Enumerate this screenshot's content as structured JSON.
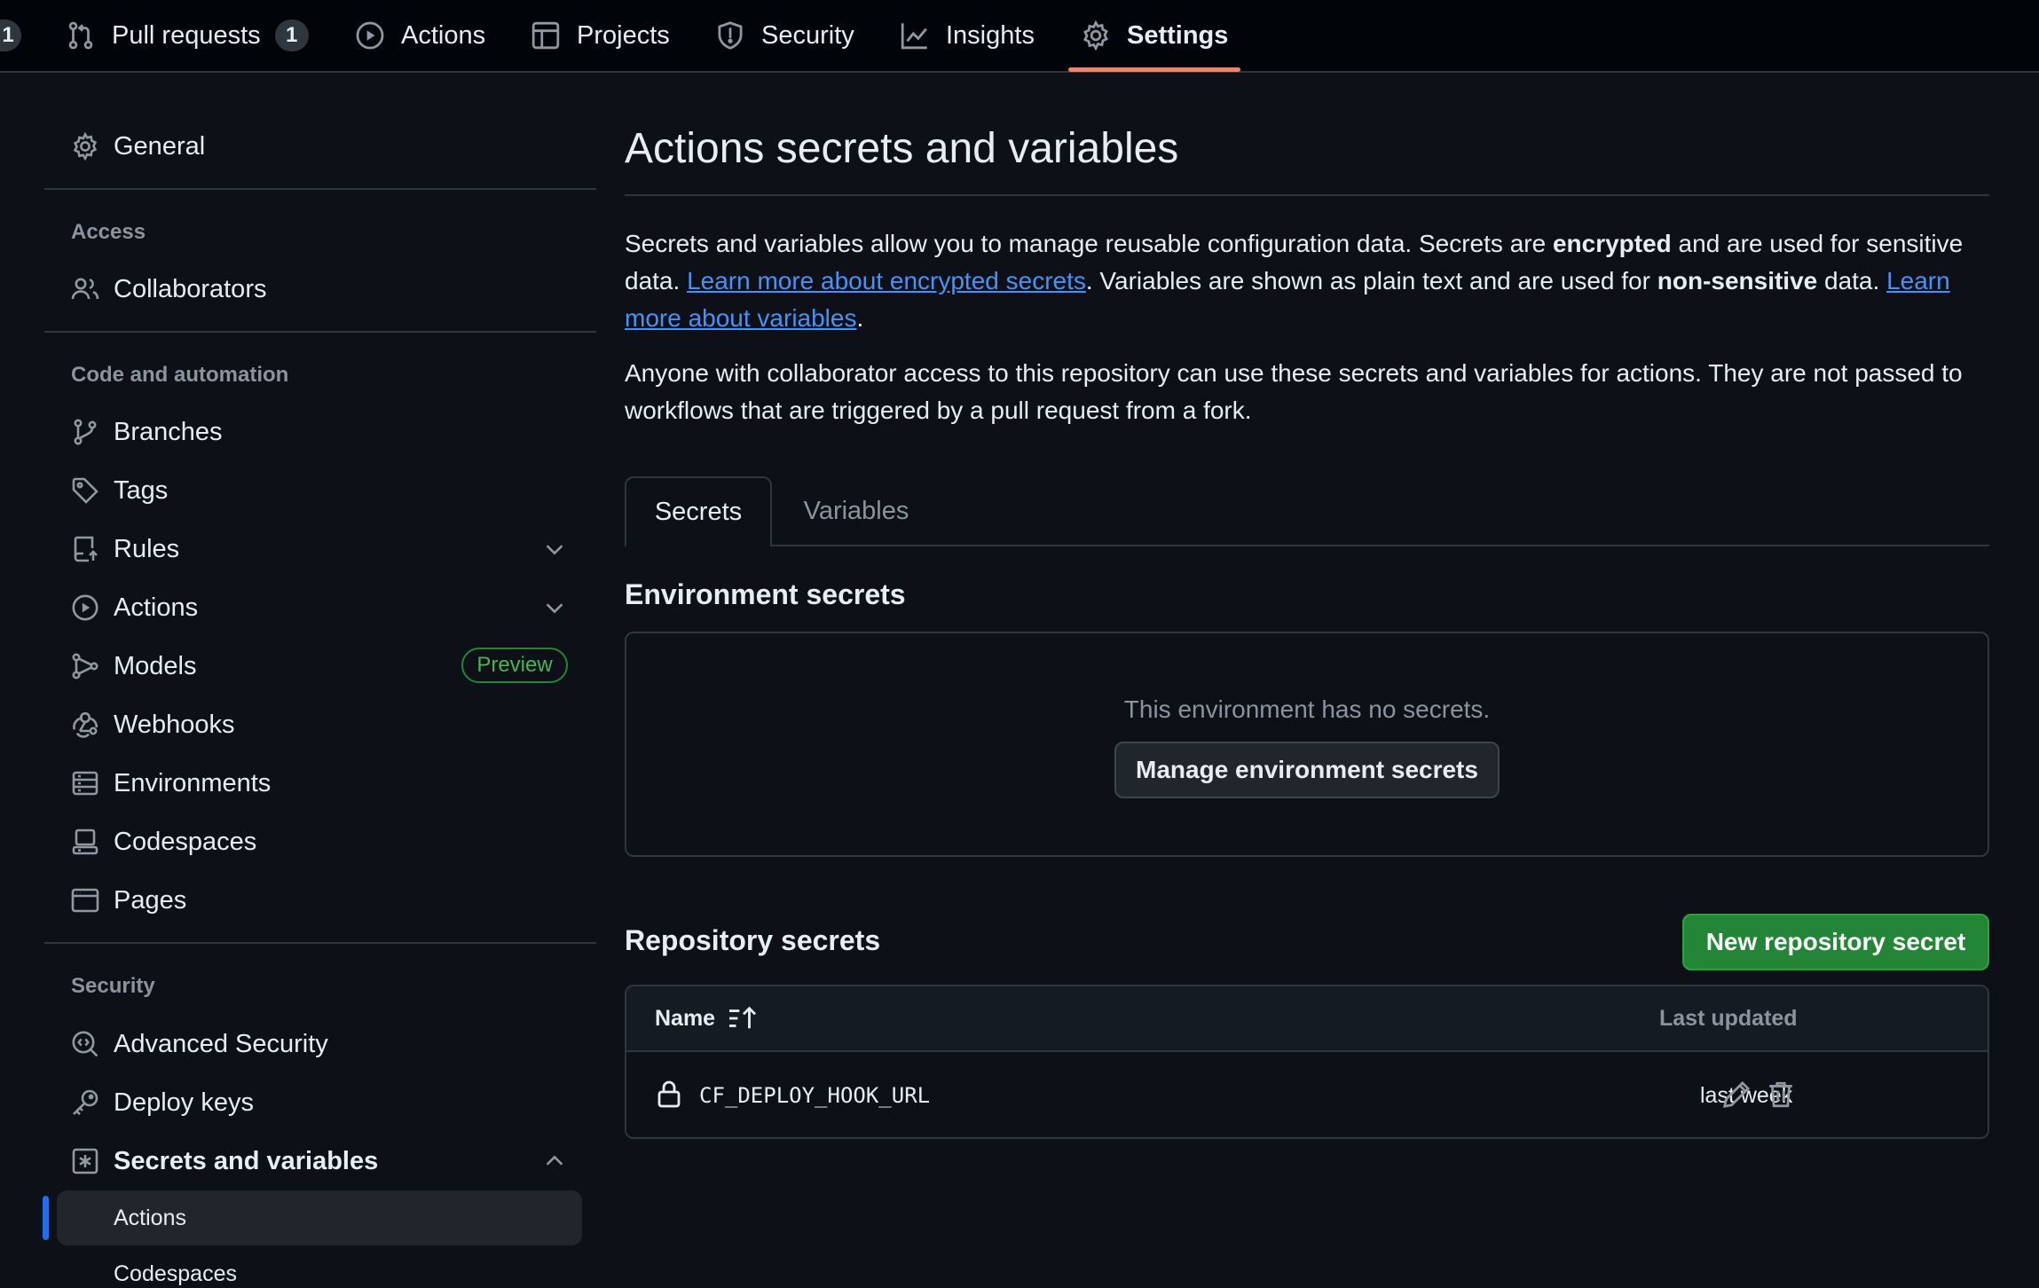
{
  "topnav": {
    "leading_counter": "1",
    "tabs": [
      {
        "label": "Pull requests",
        "counter": "1",
        "icon": "git-pull-request-icon"
      },
      {
        "label": "Actions",
        "icon": "play-icon"
      },
      {
        "label": "Projects",
        "icon": "table-icon"
      },
      {
        "label": "Security",
        "icon": "shield-icon"
      },
      {
        "label": "Insights",
        "icon": "graph-icon"
      },
      {
        "label": "Settings",
        "icon": "gear-icon",
        "selected": true
      }
    ]
  },
  "sidebar": {
    "general": "General",
    "access_heading": "Access",
    "collaborators": "Collaborators",
    "code_heading": "Code and automation",
    "items": [
      {
        "label": "Branches",
        "icon": "git-branch-icon"
      },
      {
        "label": "Tags",
        "icon": "tag-icon"
      },
      {
        "label": "Rules",
        "icon": "repo-push-icon",
        "expandable": true
      },
      {
        "label": "Actions",
        "icon": "play-icon",
        "expandable": true
      },
      {
        "label": "Models",
        "icon": "models-icon",
        "badge": "Preview"
      },
      {
        "label": "Webhooks",
        "icon": "webhook-icon"
      },
      {
        "label": "Environments",
        "icon": "server-icon"
      },
      {
        "label": "Codespaces",
        "icon": "codespaces-icon"
      },
      {
        "label": "Pages",
        "icon": "browser-icon"
      }
    ],
    "security_heading": "Security",
    "security_items": [
      {
        "label": "Advanced Security",
        "icon": "codescan-icon"
      },
      {
        "label": "Deploy keys",
        "icon": "key-icon"
      },
      {
        "label": "Secrets and variables",
        "icon": "key-asterisk-icon",
        "expanded": true
      }
    ],
    "sub_items": [
      "Actions",
      "Codespaces"
    ]
  },
  "main": {
    "title": "Actions secrets and variables",
    "intro": {
      "t1": "Secrets and variables allow you to manage reusable configuration data. Secrets are ",
      "b1": "encrypted",
      "t2": " and are used for sensitive data. ",
      "link1": "Learn more about encrypted secrets",
      "t3": ". Variables are shown as plain text and are used for ",
      "b2": "non-sensitive",
      "t4": " data. ",
      "link2": "Learn more about variables",
      "t5": "."
    },
    "access_note": "Anyone with collaborator access to this repository can use these secrets and variables for actions. They are not passed to workflows that are triggered by a pull request from a fork.",
    "tabs": [
      "Secrets",
      "Variables"
    ],
    "env_heading": "Environment secrets",
    "env_empty": "This environment has no secrets.",
    "env_button": "Manage environment secrets",
    "repo_heading": "Repository secrets",
    "new_button": "New repository secret",
    "table": {
      "col_name": "Name",
      "col_updated": "Last updated",
      "rows": [
        {
          "name": "CF_DEPLOY_HOOK_URL",
          "updated": "last week"
        }
      ]
    }
  },
  "colors": {
    "background": "#0d1117",
    "header": "#010409",
    "accent_underline": "#f78166",
    "link": "#4493f8",
    "primary_button": "#238636",
    "active_marker": "#1f6feb"
  }
}
